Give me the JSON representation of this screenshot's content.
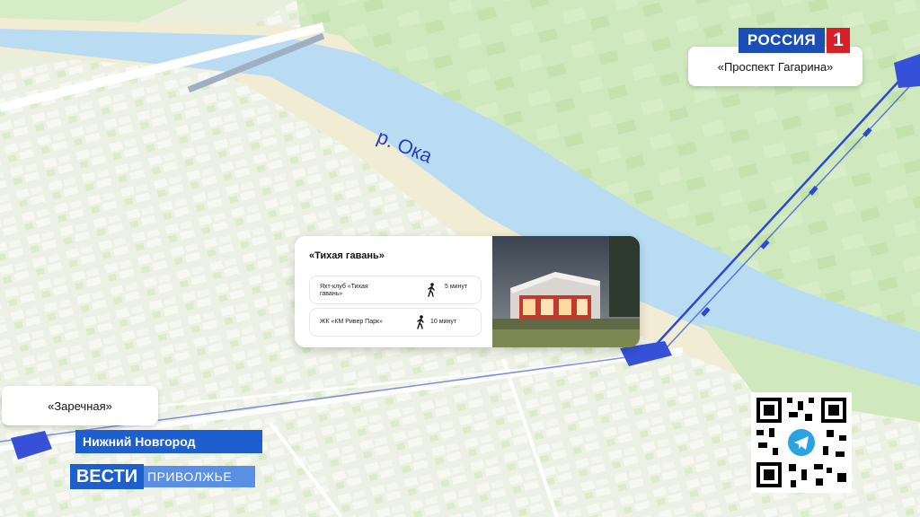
{
  "map": {
    "river_label": "р. Ока"
  },
  "stations": {
    "prospekt": "«Проспект Гагарина»",
    "zarechnaya": "«Заречная»"
  },
  "info_card": {
    "title": "«Тихая гавань»",
    "rows": [
      {
        "name": "Яхт-клуб «Тихая гавань»",
        "time": "5 минут",
        "icon": "walking-person-icon"
      },
      {
        "name": "ЖК «КМ Ривер Парк»",
        "time": "10 минут",
        "icon": "walking-person-icon"
      }
    ]
  },
  "channel": {
    "name": "РОССИЯ",
    "number": "1"
  },
  "lower_third": {
    "city": "Нижний Новгород",
    "program": "ВЕСТИ",
    "region": "ПРИВОЛЖЬЕ"
  },
  "qr": {
    "icon": "telegram-icon"
  },
  "colors": {
    "river": "#b9dcf2",
    "greenery": "#c9e6b8",
    "cable_line": "#2b49d6",
    "brand_blue": "#1e5fd0",
    "brand_red": "#d8202a"
  }
}
